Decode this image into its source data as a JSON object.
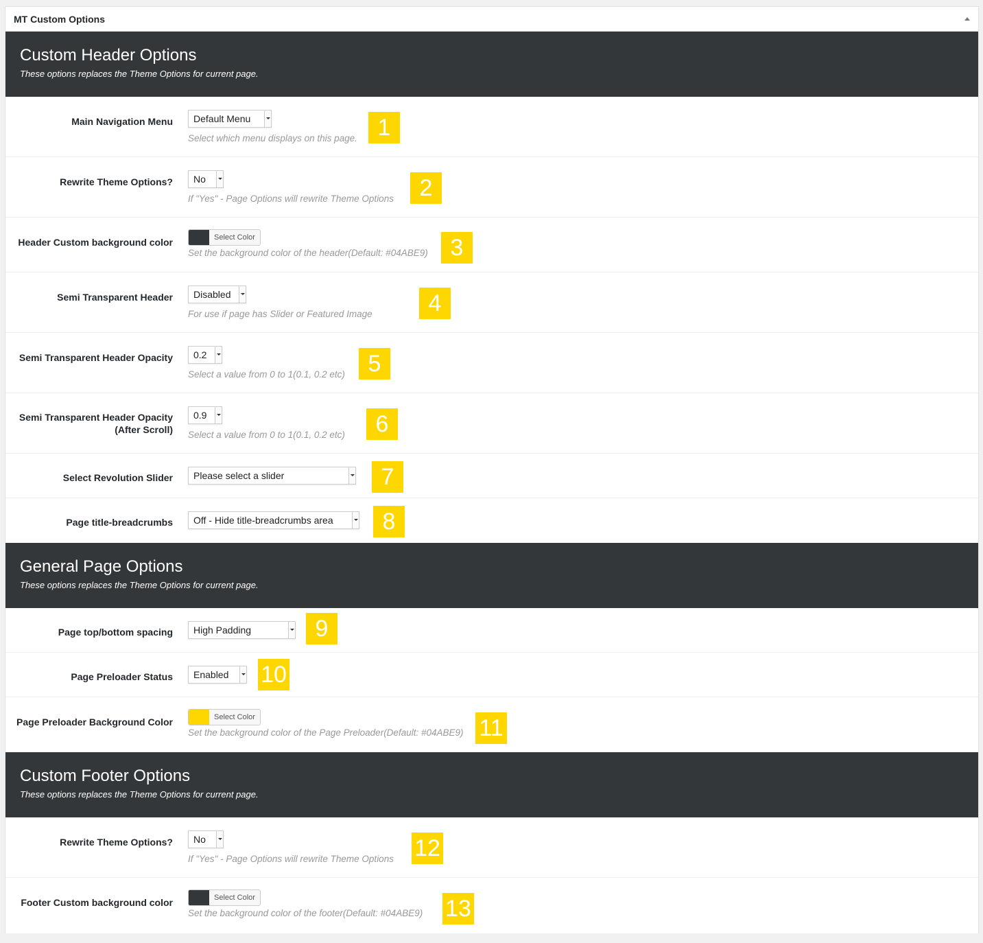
{
  "panel": {
    "title": "MT Custom Options"
  },
  "colors": {
    "section_bg": "#33373a",
    "badge": "#ffd700",
    "dark_swatch": "#33373a",
    "yellow_swatch": "#ffd700"
  },
  "sections": [
    {
      "title": "Custom Header Options",
      "subtitle": "These options replaces the Theme Options for current page."
    },
    {
      "title": "General Page Options",
      "subtitle": "These options replaces the Theme Options for current page."
    },
    {
      "title": "Custom Footer Options",
      "subtitle": "These options replaces the Theme Options for current page."
    }
  ],
  "rows": {
    "main_nav": {
      "label": "Main Navigation Menu",
      "value": "Default Menu",
      "desc": "Select which menu displays on this page.",
      "badge": "1"
    },
    "rewrite_theme": {
      "label": "Rewrite Theme Options?",
      "value": "No",
      "desc": "If \"Yes\" - Page Options will rewrite Theme Options",
      "badge": "2"
    },
    "header_bg": {
      "label": "Header Custom background color",
      "button": "Select Color",
      "desc": "Set the background color of the header(Default: #04ABE9)",
      "badge": "3"
    },
    "semi_header": {
      "label": "Semi Transparent Header",
      "value": "Disabled",
      "desc": "For use if page has Slider or Featured Image",
      "badge": "4"
    },
    "semi_opacity": {
      "label": "Semi Transparent Header Opacity",
      "value": "0.2",
      "desc": "Select a value from 0 to 1(0.1, 0.2 etc)",
      "badge": "5"
    },
    "semi_opacity_scroll": {
      "label_line1": "Semi Transparent Header Opacity",
      "label_line2": "(After Scroll)",
      "value": "0.9",
      "desc": "Select a value from 0 to 1(0.1, 0.2 etc)",
      "badge": "6"
    },
    "rev_slider": {
      "label": "Select Revolution Slider",
      "value": "Please select a slider",
      "badge": "7"
    },
    "breadcrumbs": {
      "label": "Page title-breadcrumbs",
      "value": "Off - Hide title-breadcrumbs area",
      "badge": "8"
    },
    "spacing": {
      "label": "Page top/bottom spacing",
      "value": "High Padding",
      "badge": "9"
    },
    "preloader": {
      "label": "Page Preloader Status",
      "value": "Enabled",
      "badge": "10"
    },
    "preloader_bg": {
      "label": "Page Preloader Background Color",
      "button": "Select Color",
      "desc": "Set the background color of the Page Preloader(Default: #04ABE9)",
      "badge": "11"
    },
    "footer_rewrite": {
      "label": "Rewrite Theme Options?",
      "value": "No",
      "desc": "If \"Yes\" - Page Options will rewrite Theme Options",
      "badge": "12"
    },
    "footer_bg": {
      "label": "Footer Custom background color",
      "button": "Select Color",
      "desc": "Set the background color of the footer(Default: #04ABE9)",
      "badge": "13"
    }
  }
}
